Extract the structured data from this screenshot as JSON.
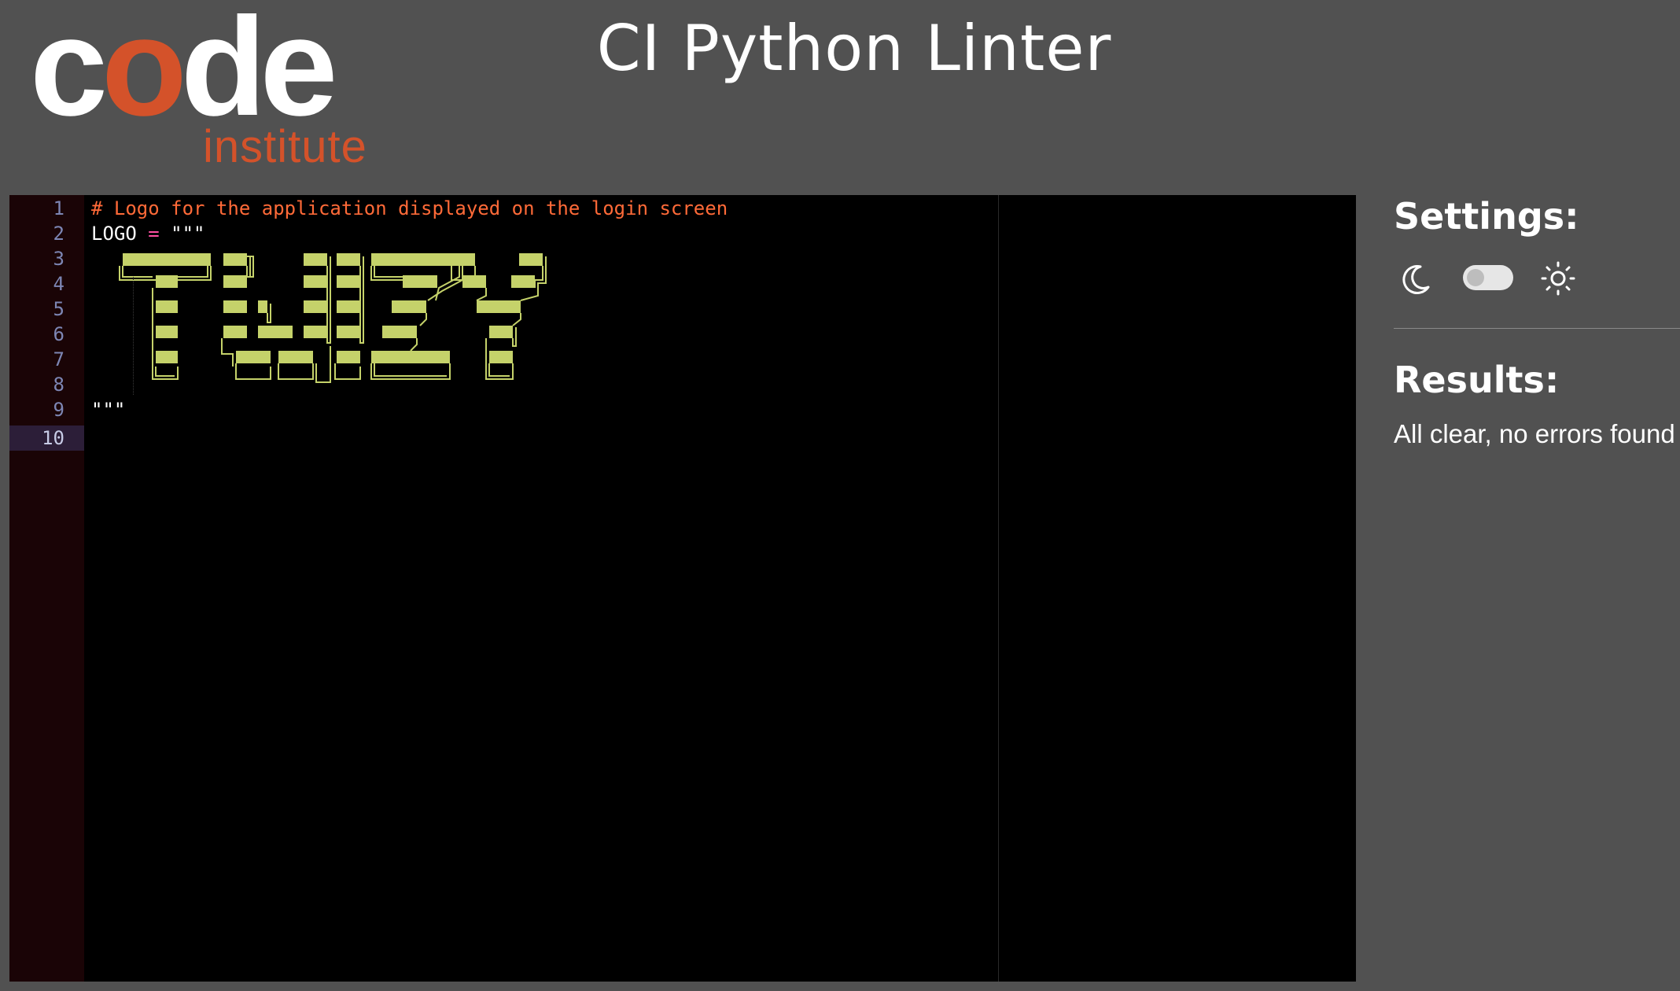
{
  "brand": {
    "logo_word_prefix": "c",
    "logo_word_accent": "o",
    "logo_word_suffix": "de",
    "logo_subtitle": "institute",
    "accent_color": "#d4522a"
  },
  "header": {
    "title": "CI Python Linter"
  },
  "editor": {
    "line_numbers": [
      "1",
      "2",
      "3",
      "4",
      "5",
      "6",
      "7",
      "8",
      "9",
      "10"
    ],
    "active_line": "10",
    "lines": {
      "comment": "# Logo for the application displayed on the login screen",
      "logo_var": "LOGO",
      "logo_operator": "=",
      "logo_string_open": "\"\"\"",
      "string_close": "\"\"\""
    },
    "ascii_art_text": "TWIZY",
    "colors": {
      "comment": "#ff6a38",
      "operator": "#ff4fa3",
      "ascii_fill": "#c5d26a",
      "background": "#000000",
      "gutter": "#1a0406"
    }
  },
  "settings": {
    "heading": "Settings:",
    "dark_mode_icon": "moon-icon",
    "light_mode_icon": "sun-icon",
    "theme_toggle_on": false
  },
  "results": {
    "heading": "Results:",
    "message": "All clear, no errors found"
  }
}
